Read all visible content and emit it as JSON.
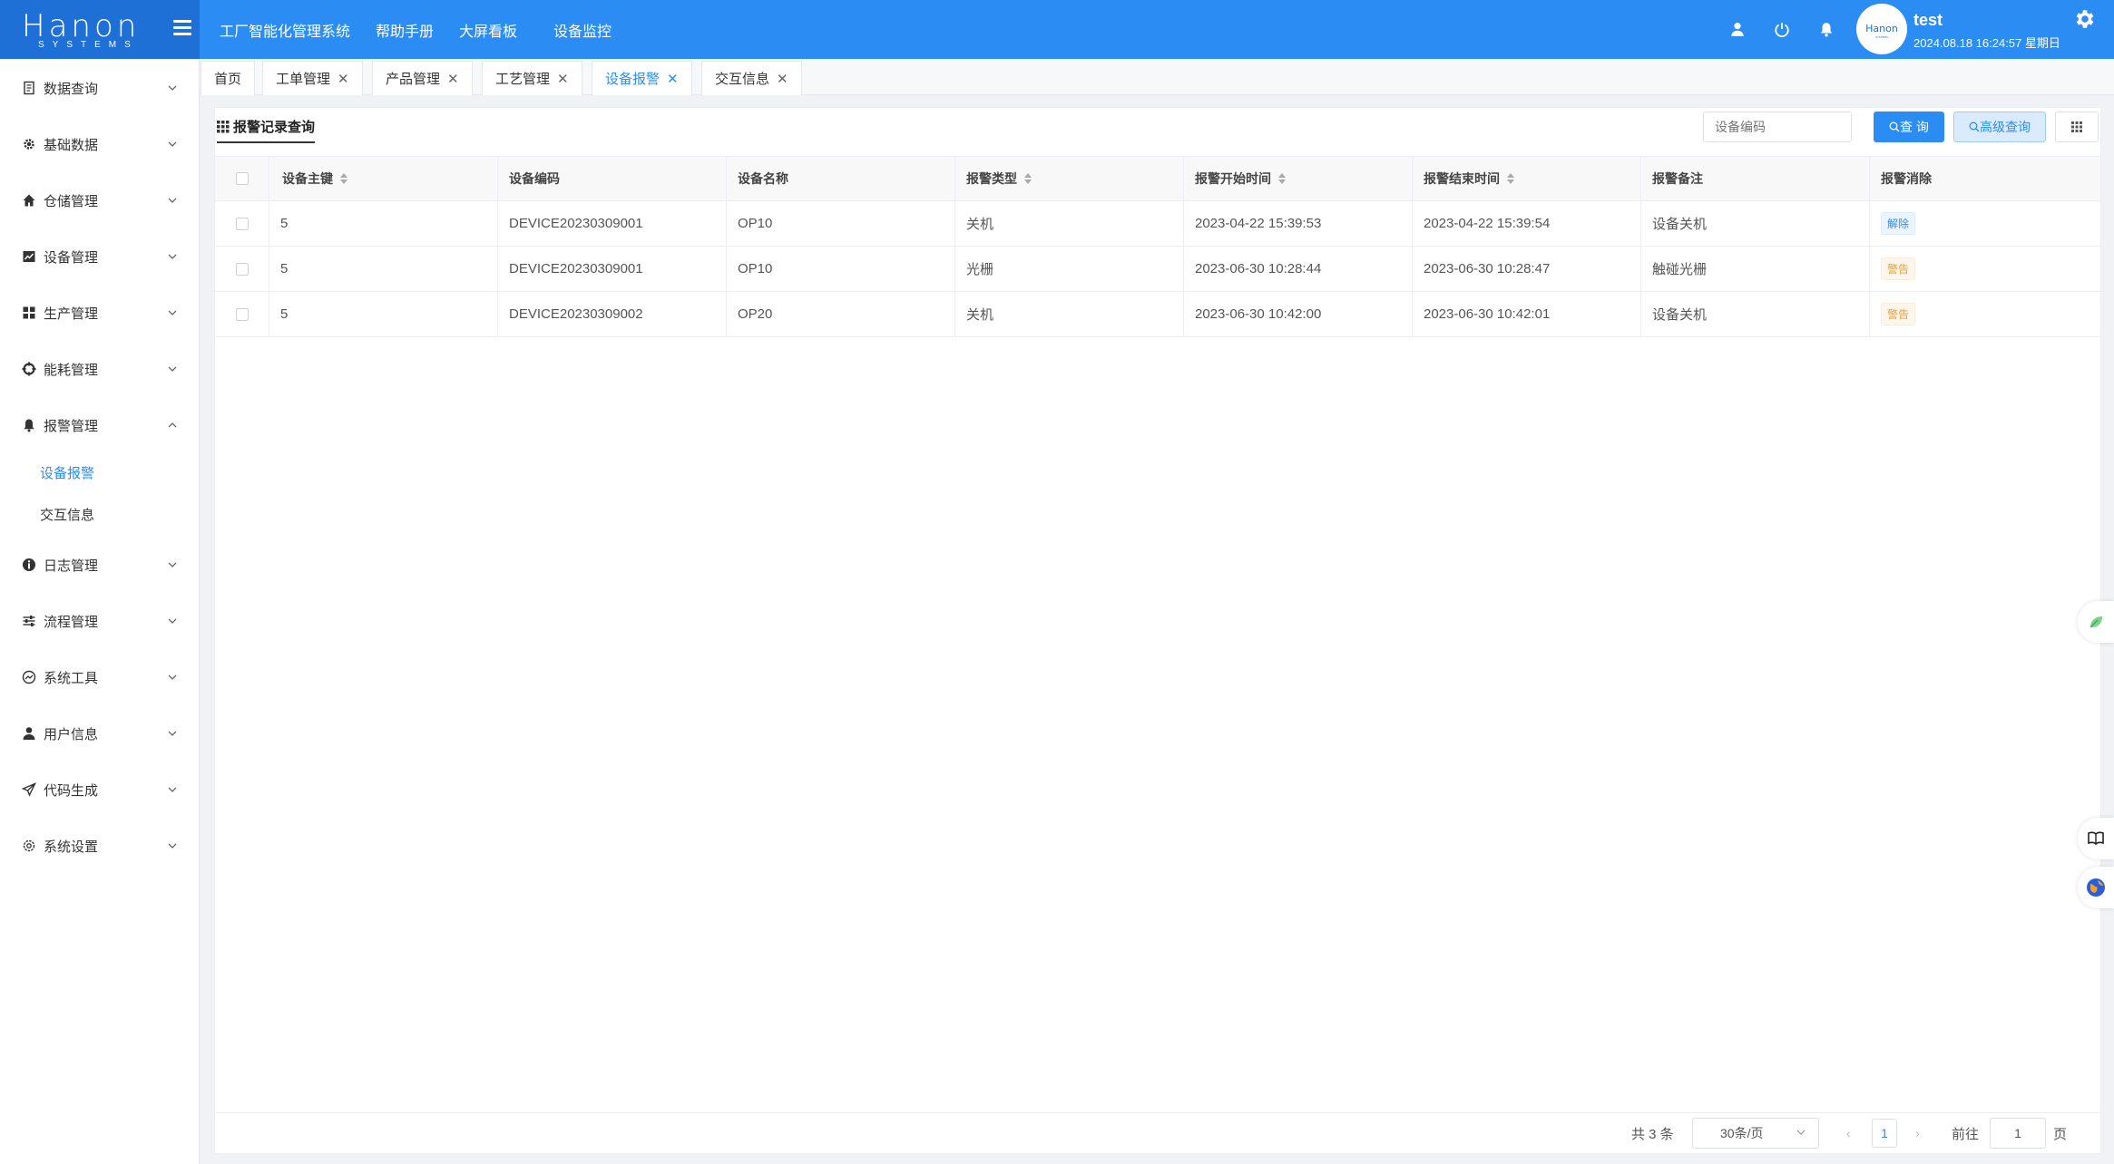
{
  "brand": {
    "logo_text": "Hanon",
    "logo_sub": "SYSTEMS"
  },
  "top_nav": [
    "工厂智能化管理系统",
    "帮助手册",
    "大屏看板",
    "设备监控"
  ],
  "user": {
    "name": "test",
    "datetime": "2024.08.18 16:24:57 星期日"
  },
  "sidebar": {
    "items": [
      {
        "label": "数据查询",
        "icon": "document-icon"
      },
      {
        "label": "基础数据",
        "icon": "gear-icon"
      },
      {
        "label": "仓储管理",
        "icon": "home-icon"
      },
      {
        "label": "设备管理",
        "icon": "chart-icon"
      },
      {
        "label": "生产管理",
        "icon": "grid-icon"
      },
      {
        "label": "能耗管理",
        "icon": "crosshair-icon"
      },
      {
        "label": "报警管理",
        "icon": "bell-icon"
      },
      {
        "label": "日志管理",
        "icon": "info-icon"
      },
      {
        "label": "流程管理",
        "icon": "sliders-icon"
      },
      {
        "label": "系统工具",
        "icon": "gauge-icon"
      },
      {
        "label": "用户信息",
        "icon": "user-icon"
      },
      {
        "label": "代码生成",
        "icon": "send-icon"
      },
      {
        "label": "系统设置",
        "icon": "settings-icon"
      }
    ],
    "subitems": [
      {
        "label": "设备报警",
        "active": true
      },
      {
        "label": "交互信息",
        "active": false
      }
    ]
  },
  "tabs": [
    {
      "label": "首页",
      "closable": false
    },
    {
      "label": "工单管理",
      "closable": true
    },
    {
      "label": "产品管理",
      "closable": true
    },
    {
      "label": "工艺管理",
      "closable": true
    },
    {
      "label": "设备报警",
      "closable": true,
      "active": true
    },
    {
      "label": "交互信息",
      "closable": true
    }
  ],
  "section_title": "报警记录查询",
  "search": {
    "placeholder": "设备编码",
    "query_label": "查 询",
    "advanced_label": "高级查询"
  },
  "table": {
    "headers": [
      "设备主键",
      "设备编码",
      "设备名称",
      "报警类型",
      "报警开始时间",
      "报警结束时间",
      "报警备注",
      "报警消除"
    ],
    "rows": [
      [
        "5",
        "DEVICE20230309001",
        "OP10",
        "关机",
        "2023-04-22 15:39:53",
        "2023-04-22 15:39:54",
        "设备关机",
        "解除"
      ],
      [
        "5",
        "DEVICE20230309001",
        "OP10",
        "光栅",
        "2023-06-30 10:28:44",
        "2023-06-30 10:28:47",
        "触碰光栅",
        "警告"
      ],
      [
        "5",
        "DEVICE20230309002",
        "OP20",
        "关机",
        "2023-06-30 10:42:00",
        "2023-06-30 10:42:01",
        "设备关机",
        "警告"
      ]
    ]
  },
  "pagination": {
    "total": "共 3 条",
    "page_size": "30条/页",
    "current": "1",
    "goto_label": "前往",
    "goto_value": "1",
    "page_suffix": "页"
  },
  "colors": {
    "primary": "#2b8df3",
    "warning": "#e6a23c"
  }
}
